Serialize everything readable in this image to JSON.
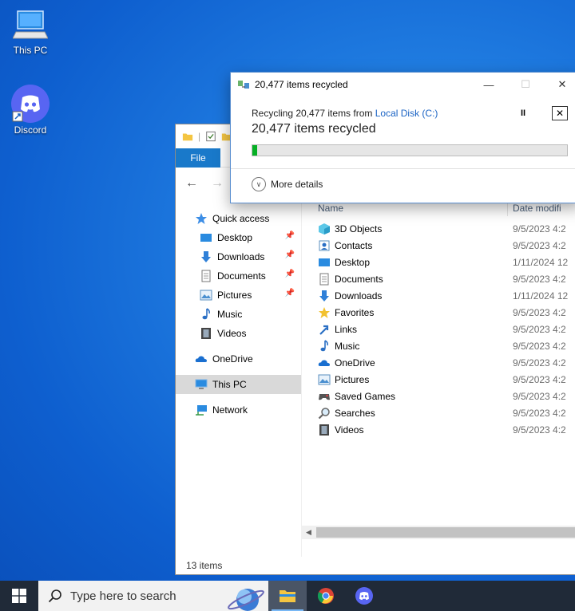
{
  "desktop": {
    "icons": [
      {
        "label": "This PC",
        "icon": "computer-icon"
      },
      {
        "label": "Discord",
        "icon": "discord-icon"
      }
    ]
  },
  "explorer": {
    "ribbon": {
      "file_tab": "File"
    },
    "nav": {
      "quick_access": "Quick access",
      "quick_items": [
        {
          "label": "Desktop",
          "pinned": true
        },
        {
          "label": "Downloads",
          "pinned": true
        },
        {
          "label": "Documents",
          "pinned": true
        },
        {
          "label": "Pictures",
          "pinned": true
        },
        {
          "label": "Music",
          "pinned": false
        },
        {
          "label": "Videos",
          "pinned": false
        }
      ],
      "onedrive": "OneDrive",
      "this_pc": "This PC",
      "network": "Network"
    },
    "columns": {
      "name": "Name",
      "date": "Date modifi"
    },
    "items": [
      {
        "name": "3D Objects",
        "date": "9/5/2023 4:2"
      },
      {
        "name": "Contacts",
        "date": "9/5/2023 4:2"
      },
      {
        "name": "Desktop",
        "date": "1/11/2024 12"
      },
      {
        "name": "Documents",
        "date": "9/5/2023 4:2"
      },
      {
        "name": "Downloads",
        "date": "1/11/2024 12"
      },
      {
        "name": "Favorites",
        "date": "9/5/2023 4:2"
      },
      {
        "name": "Links",
        "date": "9/5/2023 4:2"
      },
      {
        "name": "Music",
        "date": "9/5/2023 4:2"
      },
      {
        "name": "OneDrive",
        "date": "9/5/2023 4:2"
      },
      {
        "name": "Pictures",
        "date": "9/5/2023 4:2"
      },
      {
        "name": "Saved Games",
        "date": "9/5/2023 4:2"
      },
      {
        "name": "Searches",
        "date": "9/5/2023 4:2"
      },
      {
        "name": "Videos",
        "date": "9/5/2023 4:2"
      }
    ],
    "status": "13 items"
  },
  "dialog": {
    "title": "20,477 items recycled",
    "line1_prefix": "Recycling 20,477 items from ",
    "line1_link": "Local Disk (C:)",
    "big_status": "20,477 items recycled",
    "progress_percent": 1.5,
    "more_details": "More details",
    "pause_symbol": "II",
    "stop_symbol": "✕"
  },
  "taskbar": {
    "search_placeholder": "Type here to search"
  },
  "colors": {
    "accent": "#1979ca",
    "progress": "#06b025",
    "link": "#1a63c4"
  }
}
